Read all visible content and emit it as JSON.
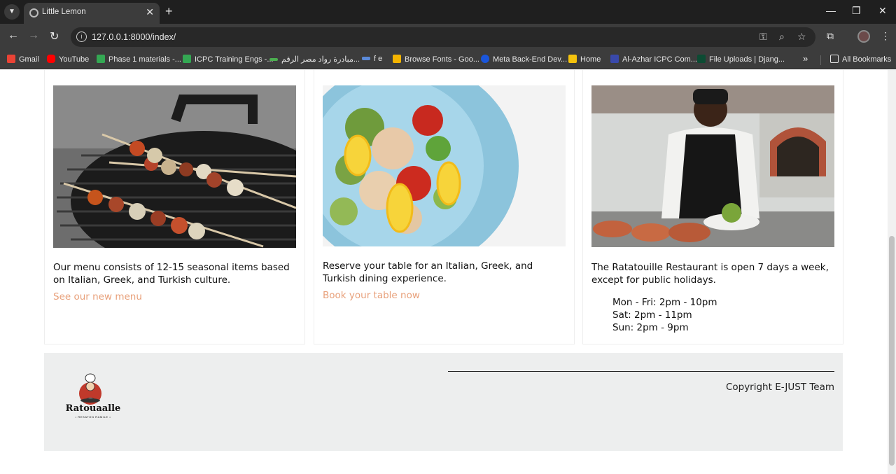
{
  "browser": {
    "tab_title": "Little Lemon",
    "url": "127.0.0.1:8000/index/",
    "bookmarks": [
      {
        "label": "Gmail",
        "color": "#ea4335"
      },
      {
        "label": "YouTube",
        "color": "#ff0000"
      },
      {
        "label": "Phase 1 materials -...",
        "color": "#34a853"
      },
      {
        "label": "ICPC Training Engs -...",
        "color": "#34a853"
      },
      {
        "label": "مبادرة رواد مصر الرقم...",
        "color": "#4caf50"
      },
      {
        "label": "f e",
        "color": "#5b8ad9"
      },
      {
        "label": "Browse Fonts - Goo...",
        "color": "#f4b400"
      },
      {
        "label": "Meta Back-End Dev...",
        "color": "#1a56db"
      },
      {
        "label": "Home",
        "color": "#f4c20d"
      },
      {
        "label": "Al-Azhar ICPC Com...",
        "color": "#3949ab"
      },
      {
        "label": "File Uploads | Djang...",
        "color": "#0c4b33"
      }
    ],
    "bookmarks_overflow": "»",
    "all_bookmarks": "All Bookmarks"
  },
  "cards": [
    {
      "text": "Our menu consists of 12-15 seasonal items based on Italian, Greek, and Turkish culture.",
      "link": "See our new menu"
    },
    {
      "text": "Reserve your table for an Italian, Greek, and Turkish dining experience.",
      "link": "Book your table now"
    },
    {
      "text": "The Ratatouille Restaurant is open 7 days a week, except for public holidays.",
      "hours": [
        "Mon - Fri: 2pm - 10pm",
        "Sat: 2pm - 11pm",
        "Sun: 2pm - 9pm"
      ]
    }
  ],
  "footer": {
    "logo_name": "Ratouaalle",
    "logo_sub": "• RESATON RAMILE •",
    "copyright": "Copyright E-JUST Team"
  },
  "colors": {
    "link": "#e8a07a",
    "footer_bg": "#edeeee"
  }
}
